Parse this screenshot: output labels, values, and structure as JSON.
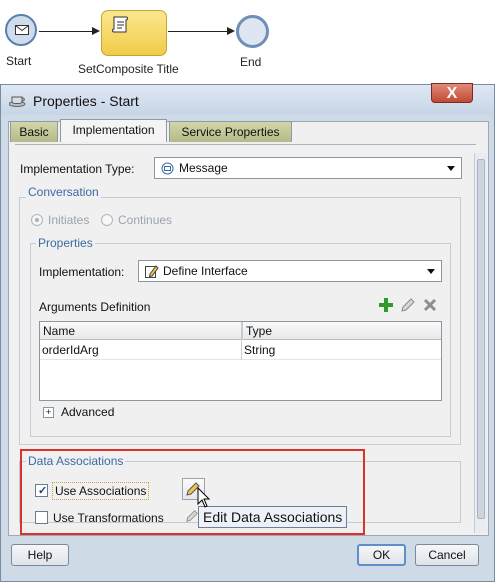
{
  "canvas": {
    "start_label": "Start",
    "task_label": "SetComposite Title",
    "end_label": "End"
  },
  "dialog": {
    "title": "Properties - Start",
    "close_glyph": "X",
    "tabs": [
      {
        "label": "Basic"
      },
      {
        "label": "Implementation",
        "active": true
      },
      {
        "label": "Service Properties"
      }
    ],
    "implementation_type_label": "Implementation Type:",
    "implementation_type_value": "Message",
    "conversation": {
      "title": "Conversation",
      "initiates": "Initiates",
      "continues": "Continues"
    },
    "properties": {
      "title": "Properties",
      "implementation_label": "Implementation:",
      "implementation_value": "Define Interface",
      "arguments_label": "Arguments Definition",
      "columns": [
        "Name",
        "Type"
      ],
      "rows": [
        {
          "name": "orderIdArg",
          "type": "String"
        }
      ],
      "advanced_label": "Advanced",
      "expand_glyph": "+"
    },
    "data_associations": {
      "title": "Data Associations",
      "use_associations": "Use Associations",
      "use_associations_checked": true,
      "use_transformations": "Use Transformations",
      "use_transformations_checked": false,
      "tooltip": "Edit Data Associations"
    },
    "buttons": {
      "help": "Help",
      "ok": "OK",
      "cancel": "Cancel"
    }
  },
  "colors": {
    "accent_blue": "#3b6aa5",
    "highlight_red": "#d9322b",
    "task_yellow": "#f1cc4a"
  }
}
